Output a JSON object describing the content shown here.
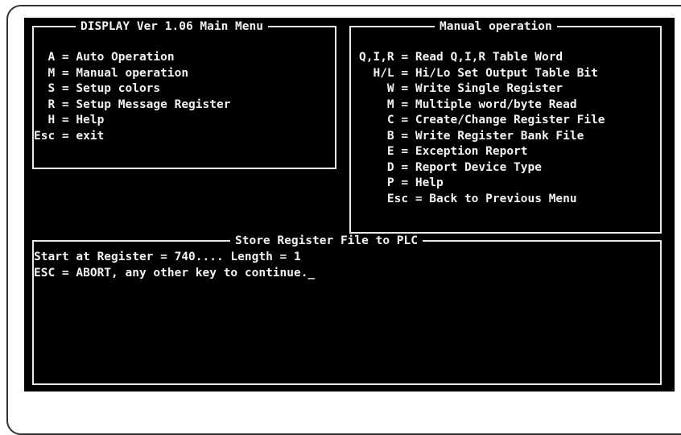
{
  "main_menu": {
    "title": "DISPLAY Ver 1.06 Main Menu",
    "items": [
      "  A = Auto Operation",
      "  M = Manual operation",
      "  S = Setup colors",
      "  R = Setup Message Register",
      "  H = Help",
      "Esc = exit"
    ]
  },
  "manual_menu": {
    "title": "Manual operation",
    "items": [
      "Q,I,R = Read Q,I,R Table Word",
      "  H/L = Hi/Lo Set Output Table Bit",
      "    W = Write Single Register",
      "    M = Multiple word/byte Read",
      "    C = Create/Change Register File",
      "    B = Write Register Bank File",
      "    E = Exception Report",
      "    D = Report Device Type",
      "    P = Help",
      "    Esc = Back to Previous Menu"
    ]
  },
  "store_panel": {
    "title": "Store Register File to PLC",
    "line1": "Start at Register = 740.... Length = 1",
    "line2": "ESC = ABORT, any other key to continue.",
    "cursor": "_"
  }
}
